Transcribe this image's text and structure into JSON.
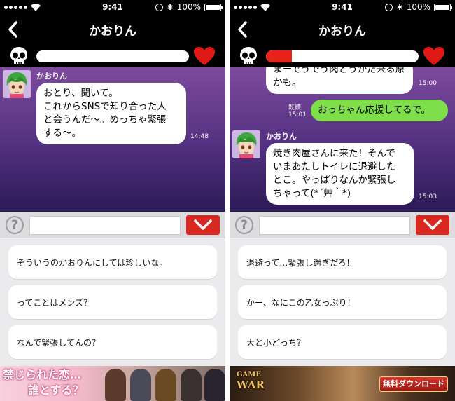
{
  "status_bar": {
    "time": "9:41",
    "battery": "100%"
  },
  "screens": [
    {
      "title": "かおりん",
      "meter_level": 0,
      "messages": [
        {
          "sender": "かおりん",
          "lines": [
            "おとり、聞いて。",
            "これからSNSで知り合った人",
            "と会うんだ〜。めっちゃ緊張",
            "する〜。"
          ],
          "time": "14:48"
        }
      ],
      "help_symbol": "?",
      "question_input": "",
      "options": [
        "そういうのかおりんにしては珍しいな。",
        "ってことはメンズ？",
        "なんで緊張してんの？"
      ],
      "banner": {
        "line1": "禁じられた恋…",
        "line2": "誰とする？"
      }
    },
    {
      "title": "かおりん",
      "meter_level": 0.17,
      "messages": [
        {
          "lines": [
            "まーでうでう肉とうかだ来る原",
            "かも。"
          ],
          "time": "15:00"
        },
        {
          "mine": true,
          "read": "既読",
          "lines": [
            "おっちゃん応援してるで。"
          ],
          "time": "15:01"
        },
        {
          "sender": "かおりん",
          "lines": [
            "焼き肉屋さんに来た！そんで",
            "いまあたしトイレに退避した",
            "とこ。やっぱりなんか緊張し",
            "ちゃって(*´艸｀*)"
          ],
          "time": "15:03"
        }
      ],
      "help_symbol": "?",
      "question_input": "",
      "options": [
        "退避って…緊張し過ぎだろ！",
        "かー、なにこの乙女っぷり！",
        "大と小どっち？"
      ],
      "banner": {
        "logo_top": "GAME",
        "logo_bottom": "WAR",
        "button": "無料ダウンロード"
      }
    }
  ]
}
